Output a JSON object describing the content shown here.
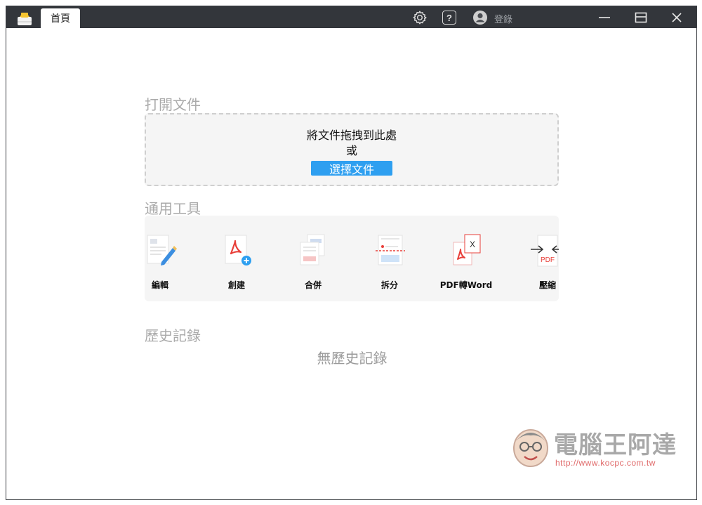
{
  "titlebar": {
    "tab_home": "首頁",
    "login_label": "登錄",
    "icons": [
      "settings-icon",
      "help-icon",
      "user-avatar-icon",
      "minimize-icon",
      "maximize-icon",
      "close-icon"
    ]
  },
  "open_section": {
    "title": "打開文件",
    "drop_text": "將文件拖拽到此處",
    "or_text": "或",
    "choose_button": "選擇文件"
  },
  "tools_section": {
    "title": "通用工具",
    "tools": [
      {
        "label": "編輯",
        "icon": "edit-icon"
      },
      {
        "label": "創建",
        "icon": "create-pdf-icon"
      },
      {
        "label": "合併",
        "icon": "merge-icon"
      },
      {
        "label": "拆分",
        "icon": "split-icon"
      },
      {
        "label": "PDF轉Word",
        "icon": "pdf-to-word-icon"
      },
      {
        "label": "壓縮",
        "icon": "compress-icon"
      }
    ]
  },
  "history_section": {
    "title": "歷史記錄",
    "empty_text": "無歷史記錄"
  },
  "watermark": {
    "title": "電腦王阿達",
    "url": "http://www.kocpc.com.tw"
  },
  "colors": {
    "titlebar": "#33363b",
    "accent": "#2e9ff0",
    "panel": "#f5f5f5",
    "pdf_red": "#e8403a"
  }
}
